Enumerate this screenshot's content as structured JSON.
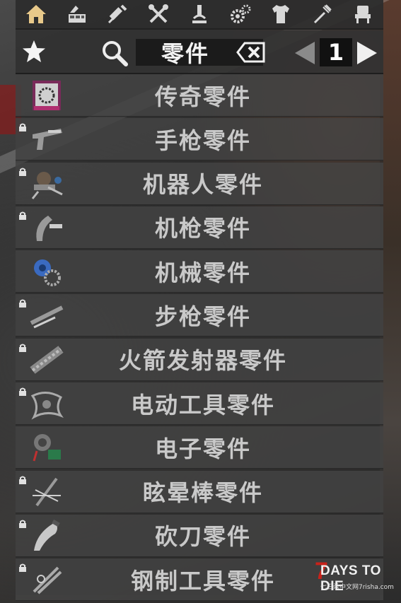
{
  "toolbar": {
    "icons": [
      "home-icon",
      "forge-icon",
      "syringe-icon",
      "tools-icon",
      "microscope-icon",
      "gears-icon",
      "shirt-icon",
      "fork-icon",
      "chair-icon"
    ],
    "active_color": "#e8c98a",
    "icon_color": "#d8d8d8"
  },
  "header": {
    "search_value": "零件",
    "page_number": "1"
  },
  "items": [
    {
      "label": "传奇零件",
      "locked": false,
      "icon": "legendary-parts-icon"
    },
    {
      "label": "手枪零件",
      "locked": true,
      "icon": "pistol-parts-icon"
    },
    {
      "label": "机器人零件",
      "locked": true,
      "icon": "robotics-parts-icon"
    },
    {
      "label": "机枪零件",
      "locked": true,
      "icon": "machine-gun-parts-icon"
    },
    {
      "label": "机械零件",
      "locked": false,
      "icon": "mechanical-parts-icon"
    },
    {
      "label": "步枪零件",
      "locked": true,
      "icon": "rifle-parts-icon"
    },
    {
      "label": "火箭发射器零件",
      "locked": true,
      "icon": "rocket-launcher-parts-icon"
    },
    {
      "label": "电动工具零件",
      "locked": true,
      "icon": "power-tool-parts-icon"
    },
    {
      "label": "电子零件",
      "locked": false,
      "icon": "electronic-parts-icon"
    },
    {
      "label": "眩晕棒零件",
      "locked": true,
      "icon": "stun-baton-parts-icon"
    },
    {
      "label": "砍刀零件",
      "locked": true,
      "icon": "machete-parts-icon"
    },
    {
      "label": "钢制工具零件",
      "locked": true,
      "icon": "steel-tool-parts-icon"
    }
  ],
  "watermark": {
    "title_digit": "7",
    "title": "DAYS TO DIE",
    "sub": "七日杀中文网7risha.com"
  }
}
